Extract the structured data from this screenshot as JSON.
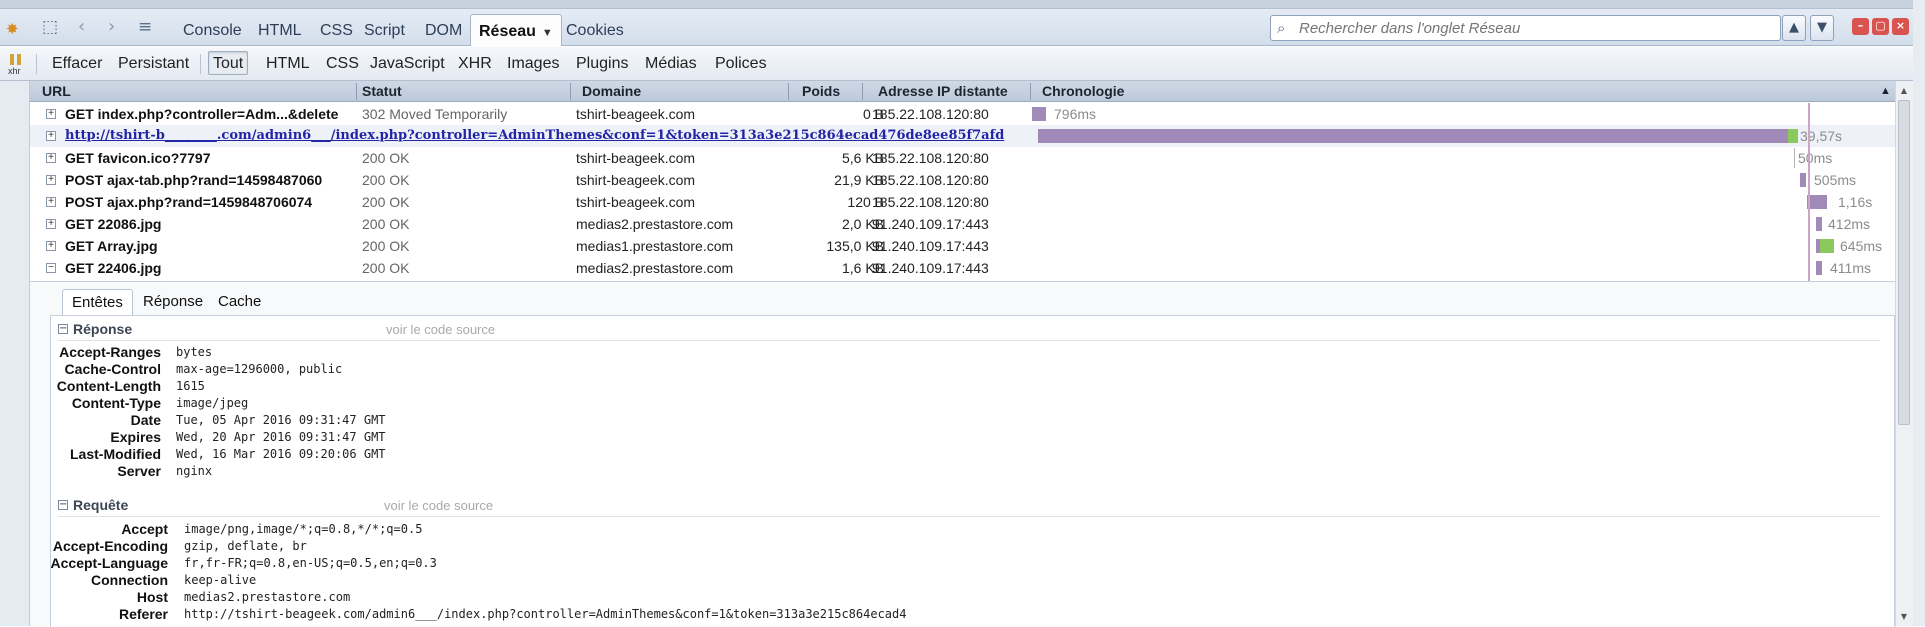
{
  "toolbar": {
    "tabs": [
      "Console",
      "HTML",
      "CSS",
      "Script",
      "DOM",
      "Réseau",
      "Cookies"
    ],
    "search_placeholder": "Rechercher dans l'onglet Réseau"
  },
  "filters": {
    "actions": [
      "Effacer",
      "Persistant"
    ],
    "types": [
      "Tout",
      "HTML",
      "CSS",
      "JavaScript",
      "XHR",
      "Images",
      "Plugins",
      "Médias",
      "Polices"
    ],
    "active": "Tout",
    "xhr_icon_label": "xhr"
  },
  "columns": [
    "URL",
    "Statut",
    "Domaine",
    "Poids",
    "Adresse IP distante",
    "Chronologie"
  ],
  "requests": [
    {
      "url": "GET index.php?controller=Adm...&delete",
      "status": "302 Moved Temporarily",
      "domain": "tshirt-beageek.com",
      "size": "0 B",
      "ip": "185.22.108.120:80",
      "time": "796ms",
      "expand": "+"
    },
    {
      "url": "http://tshirt-b________.com/admin6___/index.php?controller=AdminThemes&conf=1&token=313a3e215c864ecad476de8ee85f7afd",
      "status": "",
      "domain": "",
      "size": "",
      "ip": "",
      "time": "39,57s",
      "expand": "+"
    },
    {
      "url": "GET favicon.ico?7797",
      "status": "200 OK",
      "domain": "tshirt-beageek.com",
      "size": "5,6 KB",
      "ip": "185.22.108.120:80",
      "time": "50ms",
      "expand": "+"
    },
    {
      "url": "POST ajax-tab.php?rand=14598487060",
      "status": "200 OK",
      "domain": "tshirt-beageek.com",
      "size": "21,9 KB",
      "ip": "185.22.108.120:80",
      "time": "505ms",
      "expand": "+"
    },
    {
      "url": "POST ajax.php?rand=1459848706074",
      "status": "200 OK",
      "domain": "tshirt-beageek.com",
      "size": "120 B",
      "ip": "185.22.108.120:80",
      "time": "1,16s",
      "expand": "+"
    },
    {
      "url": "GET 22086.jpg",
      "status": "200 OK",
      "domain": "medias2.prestastore.com",
      "size": "2,0 KB",
      "ip": "91.240.109.17:443",
      "time": "412ms",
      "expand": "+"
    },
    {
      "url": "GET Array.jpg",
      "status": "200 OK",
      "domain": "medias1.prestastore.com",
      "size": "135,0 KB",
      "ip": "91.240.109.17:443",
      "time": "645ms",
      "expand": "+"
    },
    {
      "url": "GET 22406.jpg",
      "status": "200 OK",
      "domain": "medias2.prestastore.com",
      "size": "1,6 KB",
      "ip": "91.240.109.17:443",
      "time": "411ms",
      "expand": "−"
    }
  ],
  "details": {
    "tabs": [
      "Entêtes",
      "Réponse",
      "Cache"
    ],
    "response": {
      "title": "Réponse",
      "view_source": "voir le code source",
      "headers": [
        {
          "name": "Accept-Ranges",
          "value": "bytes"
        },
        {
          "name": "Cache-Control",
          "value": "max-age=1296000, public"
        },
        {
          "name": "Content-Length",
          "value": "1615"
        },
        {
          "name": "Content-Type",
          "value": "image/jpeg"
        },
        {
          "name": "Date",
          "value": "Tue, 05 Apr 2016 09:31:47 GMT"
        },
        {
          "name": "Expires",
          "value": "Wed, 20 Apr 2016 09:31:47 GMT"
        },
        {
          "name": "Last-Modified",
          "value": "Wed, 16 Mar 2016 09:20:06 GMT"
        },
        {
          "name": "Server",
          "value": "nginx"
        }
      ]
    },
    "request": {
      "title": "Requête",
      "view_source": "voir le code source",
      "headers": [
        {
          "name": "Accept",
          "value": "image/png,image/*;q=0.8,*/*;q=0.5"
        },
        {
          "name": "Accept-Encoding",
          "value": "gzip, deflate, br"
        },
        {
          "name": "Accept-Language",
          "value": "fr,fr-FR;q=0.8,en-US;q=0.5,en;q=0.3"
        },
        {
          "name": "Connection",
          "value": "keep-alive"
        },
        {
          "name": "Host",
          "value": "medias2.prestastore.com"
        },
        {
          "name": "Referer",
          "value": "http://tshirt-beageek.com/admin6___/index.php?controller=AdminThemes&conf=1&token=313a3e215c864ecad4"
        }
      ]
    }
  },
  "colors": {
    "timeline_bar": "#a08ab8",
    "timeline_bar_received": "#8bc85e",
    "link": "#2224a6"
  }
}
